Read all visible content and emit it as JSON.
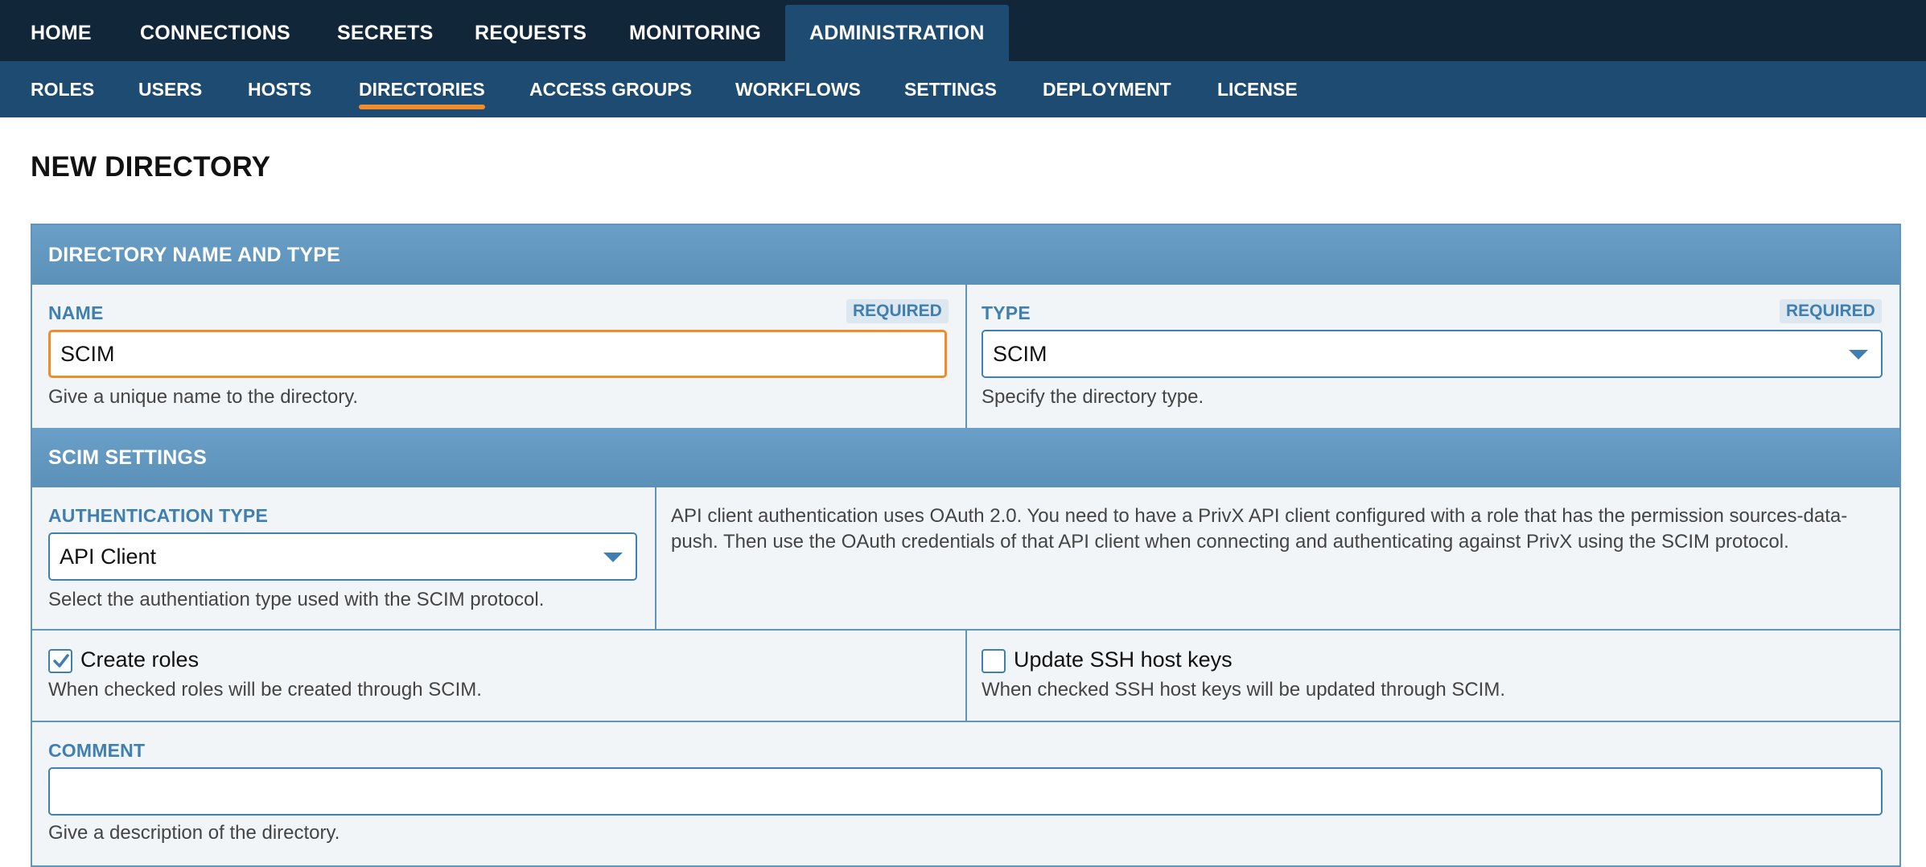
{
  "topnav": {
    "items": [
      "HOME",
      "CONNECTIONS",
      "SECRETS",
      "REQUESTS",
      "MONITORING",
      "ADMINISTRATION"
    ],
    "active": "ADMINISTRATION"
  },
  "subnav": {
    "items": [
      "ROLES",
      "USERS",
      "HOSTS",
      "DIRECTORIES",
      "ACCESS GROUPS",
      "WORKFLOWS",
      "SETTINGS",
      "DEPLOYMENT",
      "LICENSE"
    ],
    "active": "DIRECTORIES"
  },
  "page": {
    "title": "NEW DIRECTORY"
  },
  "sections": {
    "name_type": "DIRECTORY NAME AND TYPE",
    "scim": "SCIM SETTINGS"
  },
  "fields": {
    "name": {
      "label": "NAME",
      "required": "REQUIRED",
      "value": "SCIM",
      "help": "Give a unique name to the directory."
    },
    "type": {
      "label": "TYPE",
      "required": "REQUIRED",
      "value": "SCIM",
      "help": "Specify the directory type."
    },
    "auth": {
      "label": "AUTHENTICATION TYPE",
      "value": "API Client",
      "help": "Select the authentiation type used with the SCIM protocol."
    },
    "auth_info": "API client authentication uses OAuth 2.0. You need to have a PrivX API client configured with a role that has the permission sources-data-push. Then use the OAuth credentials of that API client when connecting and authenticating against PrivX using the SCIM protocol.",
    "create_roles": {
      "label": "Create roles",
      "checked": true,
      "help": "When checked roles will be created through SCIM."
    },
    "update_keys": {
      "label": "Update SSH host keys",
      "checked": false,
      "help": "When checked SSH host keys will be updated through SCIM."
    },
    "comment": {
      "label": "COMMENT",
      "value": "",
      "help": "Give a description of the directory."
    }
  },
  "colors": {
    "topnav": "#12263a",
    "subnav": "#1d4b72",
    "accent": "#f08c2a",
    "section": "#6aa0c8",
    "label": "#3f7fb1"
  }
}
